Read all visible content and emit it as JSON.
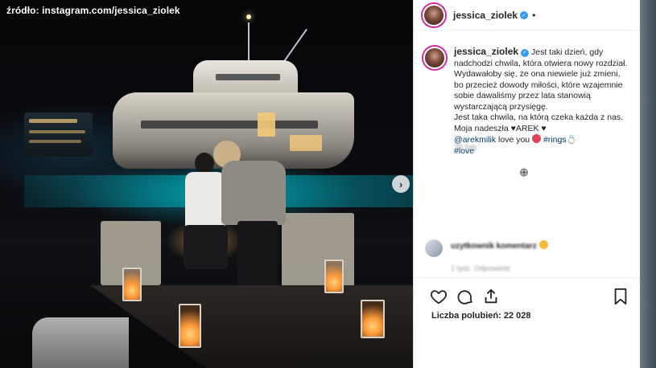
{
  "source_caption": "źródło: instagram.com/jessica_ziolek",
  "header": {
    "username": "jessica_ziolek",
    "separator": "•"
  },
  "caption": {
    "username": "jessica_ziolek",
    "lines": [
      "Jest taki dzień, gdy nadchodzi chwila, która otwiera nowy rozdział. Wydawałoby się, że ona niewiele już zmieni, bo przecież dowody miłości, które wzajemnie sobie dawaliśmy przez lata stanowią wystarczającą przysięgę.",
      "Jest taka chwila, na którą czeka każda z nas. Moja nadeszła"
    ],
    "name_tag": "AREK",
    "mention": "@arekmilik",
    "love_you": "love you",
    "hashtag_rings": "#rings",
    "hashtag_love": "#love"
  },
  "caption_time": "20 tyg.",
  "comment": {
    "text": "uzytkownik komentarz",
    "meta": "1 tydz.   Odpowiedz"
  },
  "likes": {
    "label": "Liczba polubień: 22 028"
  },
  "icons": {
    "heart": "heart-icon",
    "comment": "comment-icon",
    "share": "share-icon",
    "bookmark": "bookmark-icon",
    "verified": "verified-icon",
    "load_more": "load-more-icon",
    "next": "chevron-right-icon"
  },
  "colors": {
    "link": "#003569",
    "verified": "#3897f0",
    "text": "#262626",
    "muted": "#999999"
  }
}
